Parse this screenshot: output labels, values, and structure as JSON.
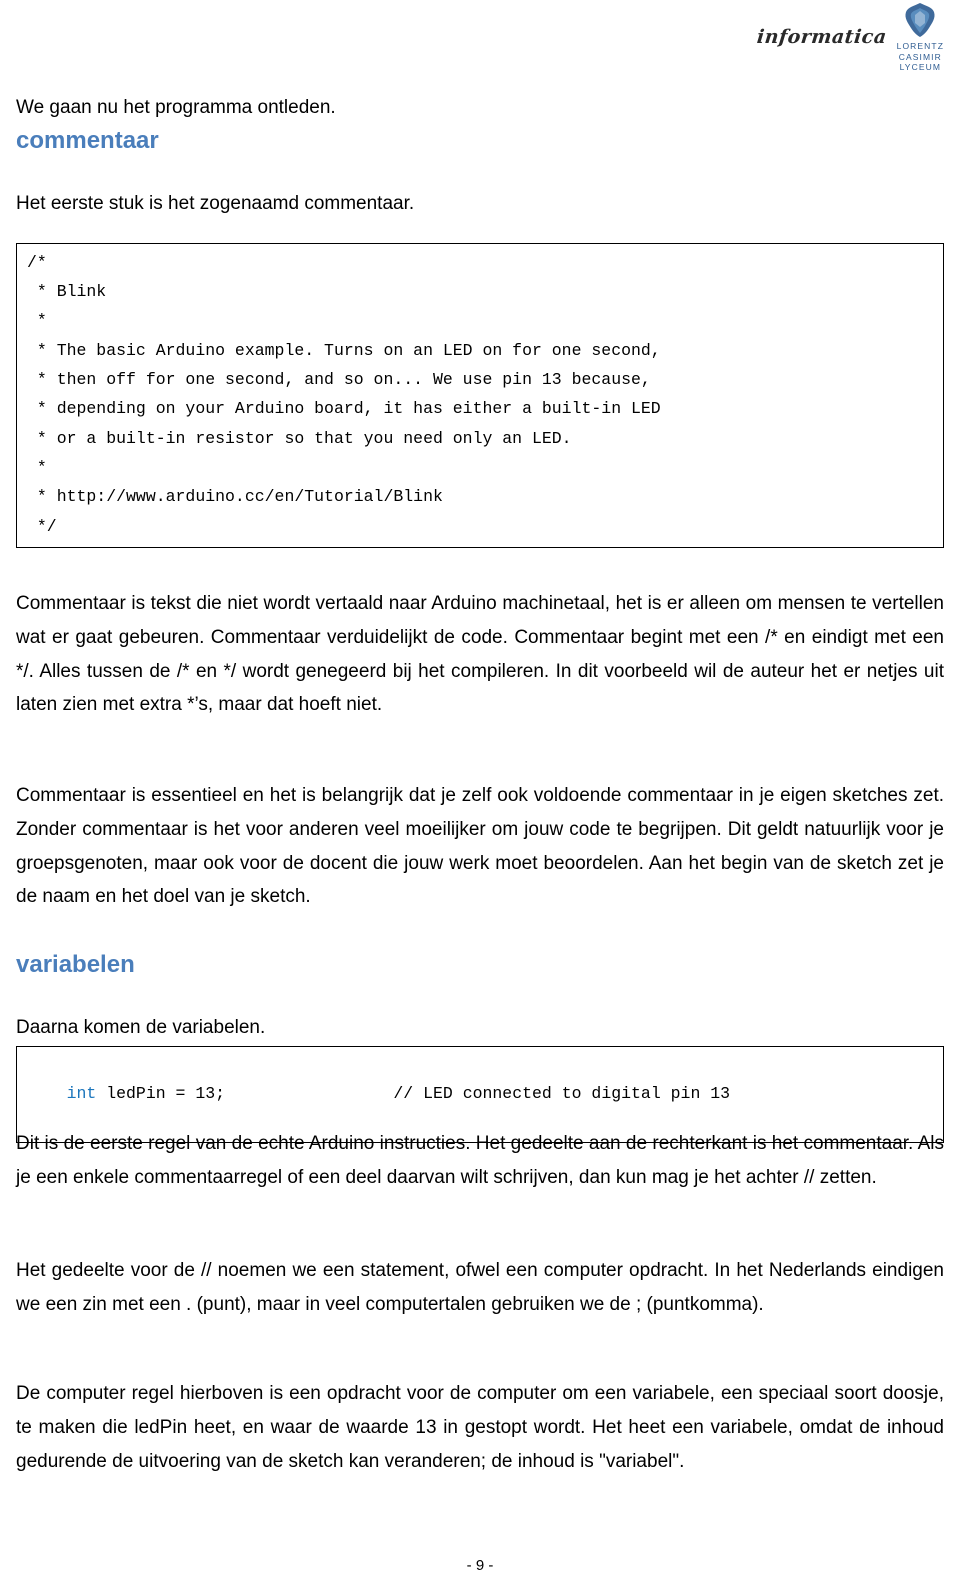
{
  "header": {
    "logo_word": "informatica",
    "crest_line_1": "LORENTZ",
    "crest_line_2": "CASIMIR",
    "crest_line_3": "LYCEUM",
    "crest_icon": "shield-crest-icon",
    "accent_color": "#2f5d92"
  },
  "document": {
    "intro_line": "We gaan nu het programma ontleden.",
    "heading_color": "#4a7ebb",
    "keyword_color": "#1a75bc"
  },
  "sections": {
    "commentaar": {
      "heading": "commentaar",
      "lead": "Het eerste stuk is het zogenaamd commentaar.",
      "code": "/*\n * Blink\n *\n * The basic Arduino example. Turns on an LED on for one second,\n * then off for one second, and so on... We use pin 13 because,\n * depending on your Arduino board, it has either a built-in LED\n * or a built-in resistor so that you need only an LED.\n *\n * http://www.arduino.cc/en/Tutorial/Blink\n */",
      "para_1": "Commentaar is tekst die niet wordt vertaald naar Arduino machinetaal, het is er alleen om mensen te vertellen wat er gaat gebeuren. Commentaar verduidelijkt de code. Commentaar begint met een /* en eindigt met een */. Alles tussen de /* en */ wordt genegeerd bij het compileren. In dit voorbeeld wil de auteur het er netjes uit laten zien met extra *’s, maar dat hoeft niet.",
      "para_2": "Commentaar is essentieel en het is belangrijk dat je zelf ook voldoende commentaar in je eigen sketches zet. Zonder commentaar is het voor anderen veel moeilijker om jouw code te begrijpen. Dit geldt natuurlijk voor je groepsgenoten, maar ook voor de docent die jouw werk moet beoordelen. Aan het begin van de sketch zet je de naam en het doel van je sketch."
    },
    "variabelen": {
      "heading": "variabelen",
      "lead": "Daarna komen de variabelen.",
      "code_keyword": "int",
      "code_rest": " ledPin = 13;",
      "code_comment": "// LED connected to digital pin 13",
      "para_3": "Dit is de eerste regel van de echte Arduino instructies. Het gedeelte aan de rechterkant is het commentaar. Als je een enkele commentaarregel of een deel daarvan wilt schrijven, dan kun mag je het achter // zetten.",
      "para_4": "Het gedeelte voor de // noemen we een statement, ofwel een computer opdracht. In het Nederlands eindigen we een zin met een . (punt), maar in veel computertalen gebruiken we de ; (puntkomma).",
      "para_5": "De computer regel hierboven is een opdracht voor de computer om een variabele, een speciaal soort doosje, te maken die ledPin heet, en waar de waarde 13 in gestopt wordt. Het heet een variabele, omdat de inhoud gedurende de uitvoering van de sketch kan veranderen; de inhoud is \"variabel\"."
    }
  },
  "footer": {
    "page_number": "- 9 -"
  }
}
